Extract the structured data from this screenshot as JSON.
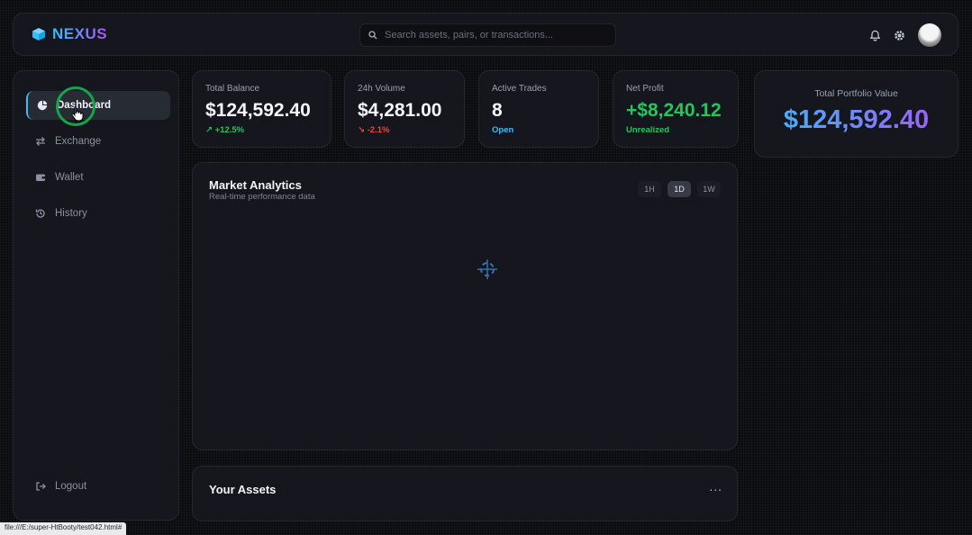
{
  "header": {
    "brand": "NEXUS",
    "search_placeholder": "Search assets, pairs, or transactions...",
    "icons": [
      "bell-icon",
      "gear-icon",
      "avatar"
    ]
  },
  "sidebar": {
    "items": [
      {
        "label": "Dashboard",
        "icon": "pie-chart-icon",
        "active": true
      },
      {
        "label": "Exchange",
        "icon": "swap-arrows-icon",
        "active": false
      },
      {
        "label": "Wallet",
        "icon": "wallet-icon",
        "active": false
      },
      {
        "label": "History",
        "icon": "history-icon",
        "active": false
      }
    ],
    "logout": "Logout"
  },
  "stats": [
    {
      "label": "Total Balance",
      "value": "$124,592.40",
      "sub": "+12.5%",
      "tone": "green"
    },
    {
      "label": "24h Volume",
      "value": "$4,281.00",
      "sub": "-2.1%",
      "tone": "red"
    },
    {
      "label": "Active Trades",
      "value": "8",
      "sub": "Open",
      "tone": "blue"
    },
    {
      "label": "Net Profit",
      "value": "+$8,240.12",
      "sub": "Unrealized",
      "tone": "green"
    }
  ],
  "portfolio": {
    "label": "Total Portfolio Value",
    "value": "$124,592.40"
  },
  "analytics": {
    "title": "Market Analytics",
    "subtitle": "Real-time performance data",
    "timeframes": [
      "1H",
      "1D",
      "1W"
    ],
    "active_timeframe": "1D"
  },
  "assets": {
    "title": "Your Assets",
    "more": "..."
  },
  "statusbar": {
    "url": "file:///E:/super-HtBooty/test042.html#"
  },
  "colors": {
    "accent_start": "#38bdf8",
    "accent_end": "#a855f7",
    "positive": "#22c55e",
    "negative": "#ef4444"
  }
}
